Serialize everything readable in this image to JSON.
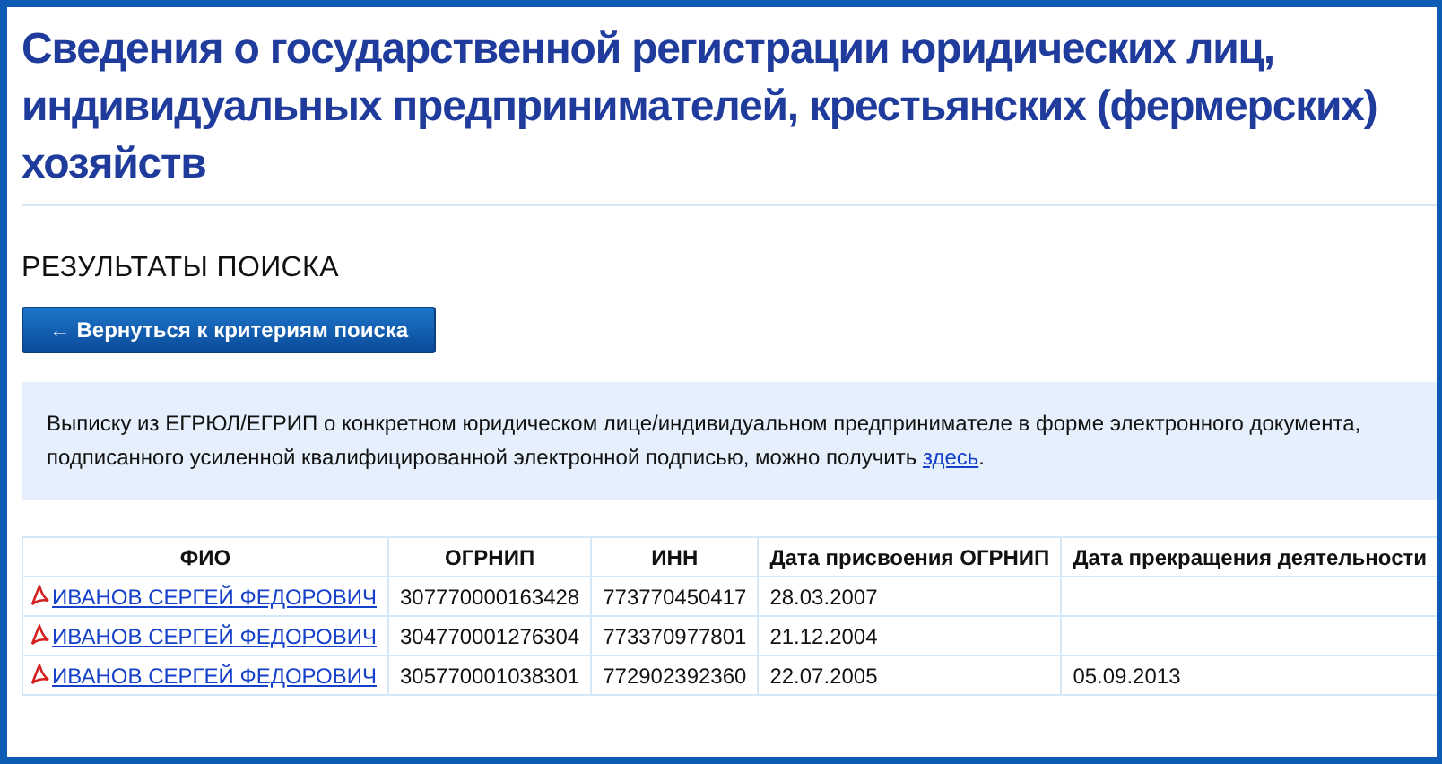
{
  "title": "Сведения о государственной регистрации юридических лиц, индивидуальных предпринимателей, крестьянских (фермерских) хозяйств",
  "section_title": "РЕЗУЛЬТАТЫ ПОИСКА",
  "back_button": {
    "label": "← Вернуться к критериям поиска"
  },
  "info": {
    "text": "Выписку из ЕГРЮЛ/ЕГРИП о конкретном юридическом лице/индивидуальном предпринимателе в форме электронного документа, подписанного усиленной квалифицированной электронной подписью, можно получить ",
    "link": "здесь",
    "end": "."
  },
  "table": {
    "columns": [
      "ФИО",
      "ОГРНИП",
      "ИНН",
      "Дата присвоения ОГРНИП",
      "Дата прекращения деятельности"
    ],
    "rows": [
      {
        "name": "ИВАНОВ СЕРГЕЙ ФЕДОРОВИЧ",
        "ogrnip": "307770000163428",
        "inn": "773770450417",
        "assigned": "28.03.2007"
      },
      {
        "name": "ИВАНОВ СЕРГЕЙ ФЕДОРОВИЧ",
        "ogrnip": "304770001276304",
        "inn": "773370977801",
        "assigned": "21.12.2004"
      },
      {
        "name": "ИВАНОВ СЕРГЕЙ ФЕДОРОВИЧ",
        "ogrnip": "305770001038301",
        "inn": "772902392360",
        "assigned": "22.07.2005",
        "terminated": "05.09.2013"
      }
    ]
  }
}
